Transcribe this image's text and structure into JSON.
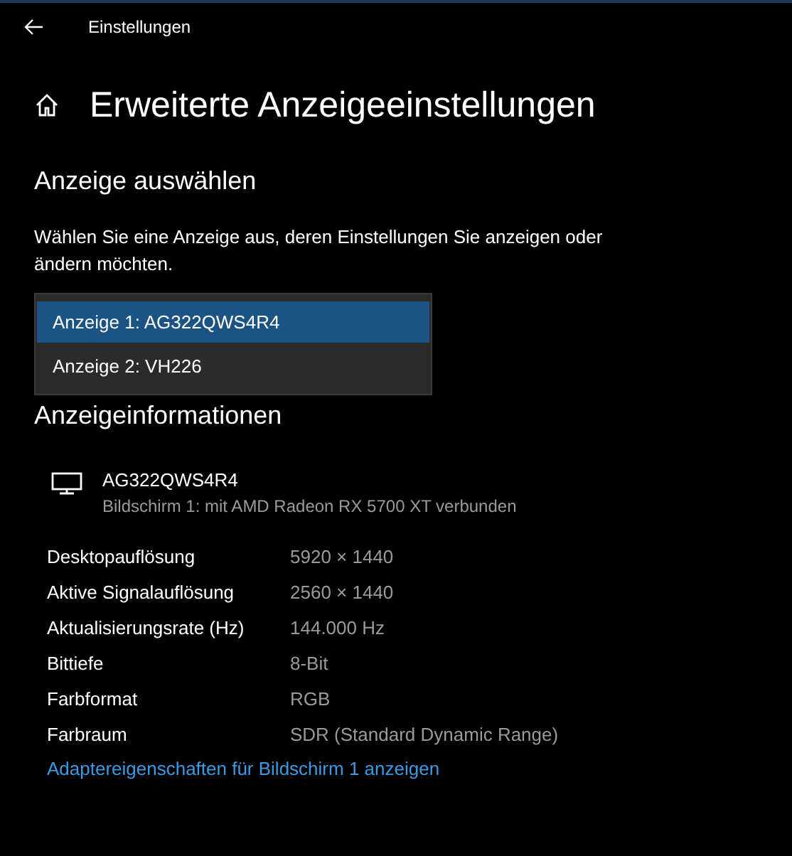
{
  "window": {
    "title": "Einstellungen"
  },
  "page_title": "Erweiterte Anzeigeeinstellungen",
  "select_section": {
    "heading": "Anzeige auswählen",
    "description": "Wählen Sie eine Anzeige aus, deren Einstellungen Sie anzeigen oder ändern möchten.",
    "options": [
      {
        "label": "Anzeige 1: AG322QWS4R4",
        "selected": true
      },
      {
        "label": "Anzeige 2: VH226",
        "selected": false
      }
    ]
  },
  "info_section": {
    "heading": "Anzeigeinformationen",
    "monitor_name": "AG322QWS4R4",
    "monitor_detail": "Bildschirm 1: mit AMD Radeon RX 5700 XT verbunden",
    "rows": [
      {
        "label": "Desktopauflösung",
        "value": "5920 × 1440"
      },
      {
        "label": "Aktive Signalauflösung",
        "value": "2560 × 1440"
      },
      {
        "label": "Aktualisierungsrate (Hz)",
        "value": "144.000 Hz"
      },
      {
        "label": "Bittiefe",
        "value": "8-Bit"
      },
      {
        "label": "Farbformat",
        "value": "RGB"
      },
      {
        "label": "Farbraum",
        "value": "SDR (Standard Dynamic Range)"
      }
    ],
    "link": "Adaptereigenschaften für Bildschirm 1 anzeigen"
  }
}
